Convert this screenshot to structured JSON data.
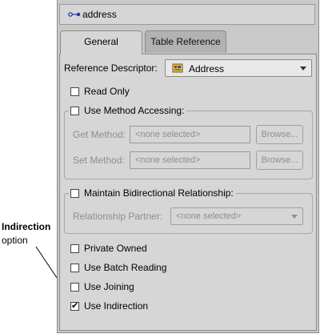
{
  "header": {
    "title": "address",
    "icon": "mapping-icon"
  },
  "tabs": [
    {
      "label": "General",
      "active": true
    },
    {
      "label": "Table Reference",
      "active": false
    }
  ],
  "general": {
    "reference_descriptor_label": "Reference Descriptor:",
    "reference_descriptor_value": "Address",
    "read_only_label": "Read Only",
    "read_only_checked": false,
    "method_accessing": {
      "label": "Use Method Accessing:",
      "checked": false,
      "get_method_label": "Get Method:",
      "get_method_value": "<none selected>",
      "set_method_label": "Set Method:",
      "set_method_value": "<none selected>",
      "browse_label": "Browse..."
    },
    "bidirectional": {
      "label": "Maintain Bidirectional Relationship:",
      "checked": false,
      "partner_label": "Relationship Partner:",
      "partner_value": "<none selected>"
    },
    "private_owned_label": "Private Owned",
    "batch_reading_label": "Use Batch Reading",
    "joining_label": "Use Joining",
    "indirection_label": "Use Indirection",
    "indirection_checked": true
  },
  "callout": {
    "title": "Indirection",
    "subtitle": "option"
  },
  "colors": {
    "panel_bg": "#d6d6d6",
    "disabled_text": "#8e8e8e"
  }
}
